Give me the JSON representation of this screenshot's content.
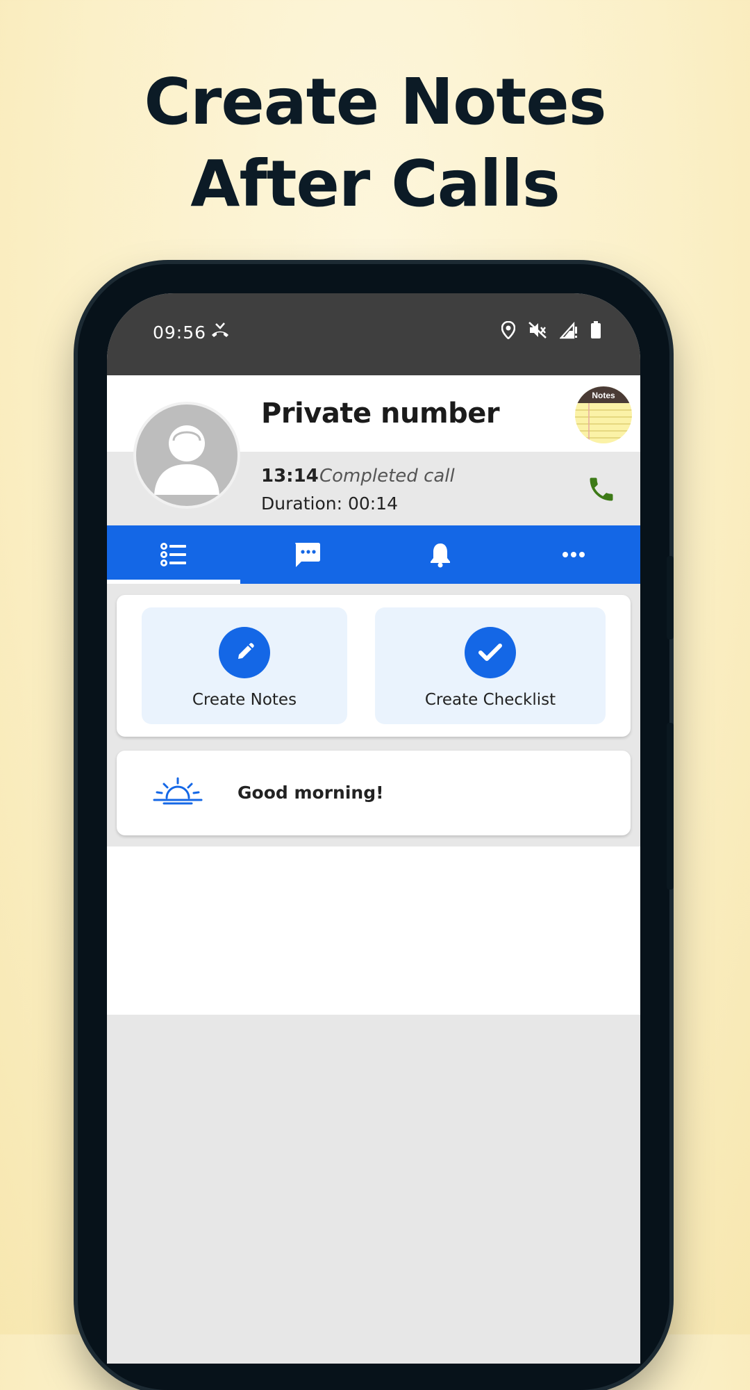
{
  "headline": {
    "line1": "Create Notes",
    "line2": "After Calls"
  },
  "status_bar": {
    "time": "09:56"
  },
  "caller": {
    "name": "Private number",
    "call_time": "13:14",
    "call_status": "Completed call",
    "duration": "Duration: 00:14"
  },
  "notes_logo_text": "Notes",
  "tabs": [
    {
      "name": "notes-list",
      "icon": "list-icon"
    },
    {
      "name": "messages",
      "icon": "message-icon"
    },
    {
      "name": "reminders",
      "icon": "bell-icon"
    },
    {
      "name": "more",
      "icon": "more-icon"
    }
  ],
  "actions": {
    "create_notes": "Create Notes",
    "create_checklist": "Create Checklist"
  },
  "greeting": "Good morning!",
  "colors": {
    "accent": "#1467e6",
    "call_green": "#2e7d1a",
    "status_bar": "#3f3f3f"
  }
}
